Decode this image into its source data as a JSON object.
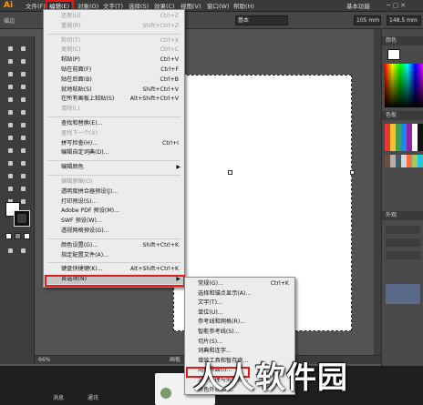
{
  "app": {
    "logo": "Ai",
    "workspace": "基本功能"
  },
  "menubar": {
    "items": [
      "文件(F)",
      "编辑(E)",
      "对象(O)",
      "文字(T)",
      "选择(S)",
      "效果(C)",
      "视图(V)",
      "窗口(W)",
      "帮助(H)"
    ],
    "active_index": 1
  },
  "optionbar": {
    "stroke_label": "描边",
    "style_value": "基本",
    "width_value": "105 mm",
    "height_value": "148.5 mm"
  },
  "panels": {
    "color": "颜色",
    "swatches": "色板",
    "appearance": "外观"
  },
  "edit_menu": {
    "items": [
      {
        "label": "还原(U)",
        "shortcut": "Ctrl+Z",
        "disabled": true
      },
      {
        "label": "重做(R)",
        "shortcut": "Shift+Ctrl+Z",
        "disabled": true
      },
      {
        "sep": true
      },
      {
        "label": "剪切(T)",
        "shortcut": "Ctrl+X",
        "disabled": true
      },
      {
        "label": "复制(C)",
        "shortcut": "Ctrl+C",
        "disabled": true
      },
      {
        "label": "粘贴(P)",
        "shortcut": "Ctrl+V"
      },
      {
        "label": "贴在前面(F)",
        "shortcut": "Ctrl+F"
      },
      {
        "label": "贴在后面(B)",
        "shortcut": "Ctrl+B"
      },
      {
        "label": "就地粘贴(S)",
        "shortcut": "Shift+Ctrl+V"
      },
      {
        "label": "在所有画板上粘贴(S)",
        "shortcut": "Alt+Shift+Ctrl+V"
      },
      {
        "label": "清除(L)",
        "shortcut": "",
        "disabled": true
      },
      {
        "sep": true
      },
      {
        "label": "查找和替换(E)...",
        "shortcut": ""
      },
      {
        "label": "查找下一个(X)",
        "shortcut": "",
        "disabled": true
      },
      {
        "label": "拼写检查(H)...",
        "shortcut": "Ctrl+I"
      },
      {
        "label": "编辑自定词典(D)...",
        "shortcut": ""
      },
      {
        "sep": true
      },
      {
        "label": "编辑颜色",
        "shortcut": "",
        "submenu": true
      },
      {
        "sep": true
      },
      {
        "label": "编辑原稿(O)",
        "shortcut": "",
        "disabled": true
      },
      {
        "label": "透明度拼合器预设(J)...",
        "shortcut": ""
      },
      {
        "label": "打印预设(S)...",
        "shortcut": ""
      },
      {
        "label": "Adobe PDF 预设(M)...",
        "shortcut": ""
      },
      {
        "label": "SWF 预设(W)...",
        "shortcut": ""
      },
      {
        "label": "透视网格预设(G)...",
        "shortcut": ""
      },
      {
        "sep": true
      },
      {
        "label": "颜色设置(G)...",
        "shortcut": "Shift+Ctrl+K"
      },
      {
        "label": "指定配置文件(A)...",
        "shortcut": ""
      },
      {
        "sep": true
      },
      {
        "label": "键盘快捷键(K)...",
        "shortcut": "Alt+Shift+Ctrl+K"
      },
      {
        "label": "首选项(N)",
        "shortcut": "",
        "submenu": true,
        "hover": true
      }
    ]
  },
  "prefs_submenu": {
    "items": [
      {
        "label": "常规(G)...",
        "shortcut": "Ctrl+K"
      },
      {
        "label": "选择和锚点显示(A)...",
        "shortcut": ""
      },
      {
        "label": "文字(T)...",
        "shortcut": ""
      },
      {
        "label": "单位(U)...",
        "shortcut": ""
      },
      {
        "label": "参考线和网格(R)...",
        "shortcut": ""
      },
      {
        "label": "智能参考线(S)...",
        "shortcut": ""
      },
      {
        "label": "切片(S)...",
        "shortcut": ""
      },
      {
        "label": "词典和连字...",
        "shortcut": ""
      },
      {
        "label": "增效工具和暂存盘...",
        "shortcut": ""
      },
      {
        "label": "用户界面(I)...",
        "shortcut": ""
      },
      {
        "label": "文件处理与剪贴板...",
        "shortcut": ""
      },
      {
        "label": "黑色外观(B)...",
        "shortcut": ""
      }
    ]
  },
  "statusbar": {
    "zoom": "66%",
    "mode": "画板"
  },
  "taskbar": {
    "item1": "消息",
    "item2": "通讯"
  },
  "watermark": "人人软件园"
}
